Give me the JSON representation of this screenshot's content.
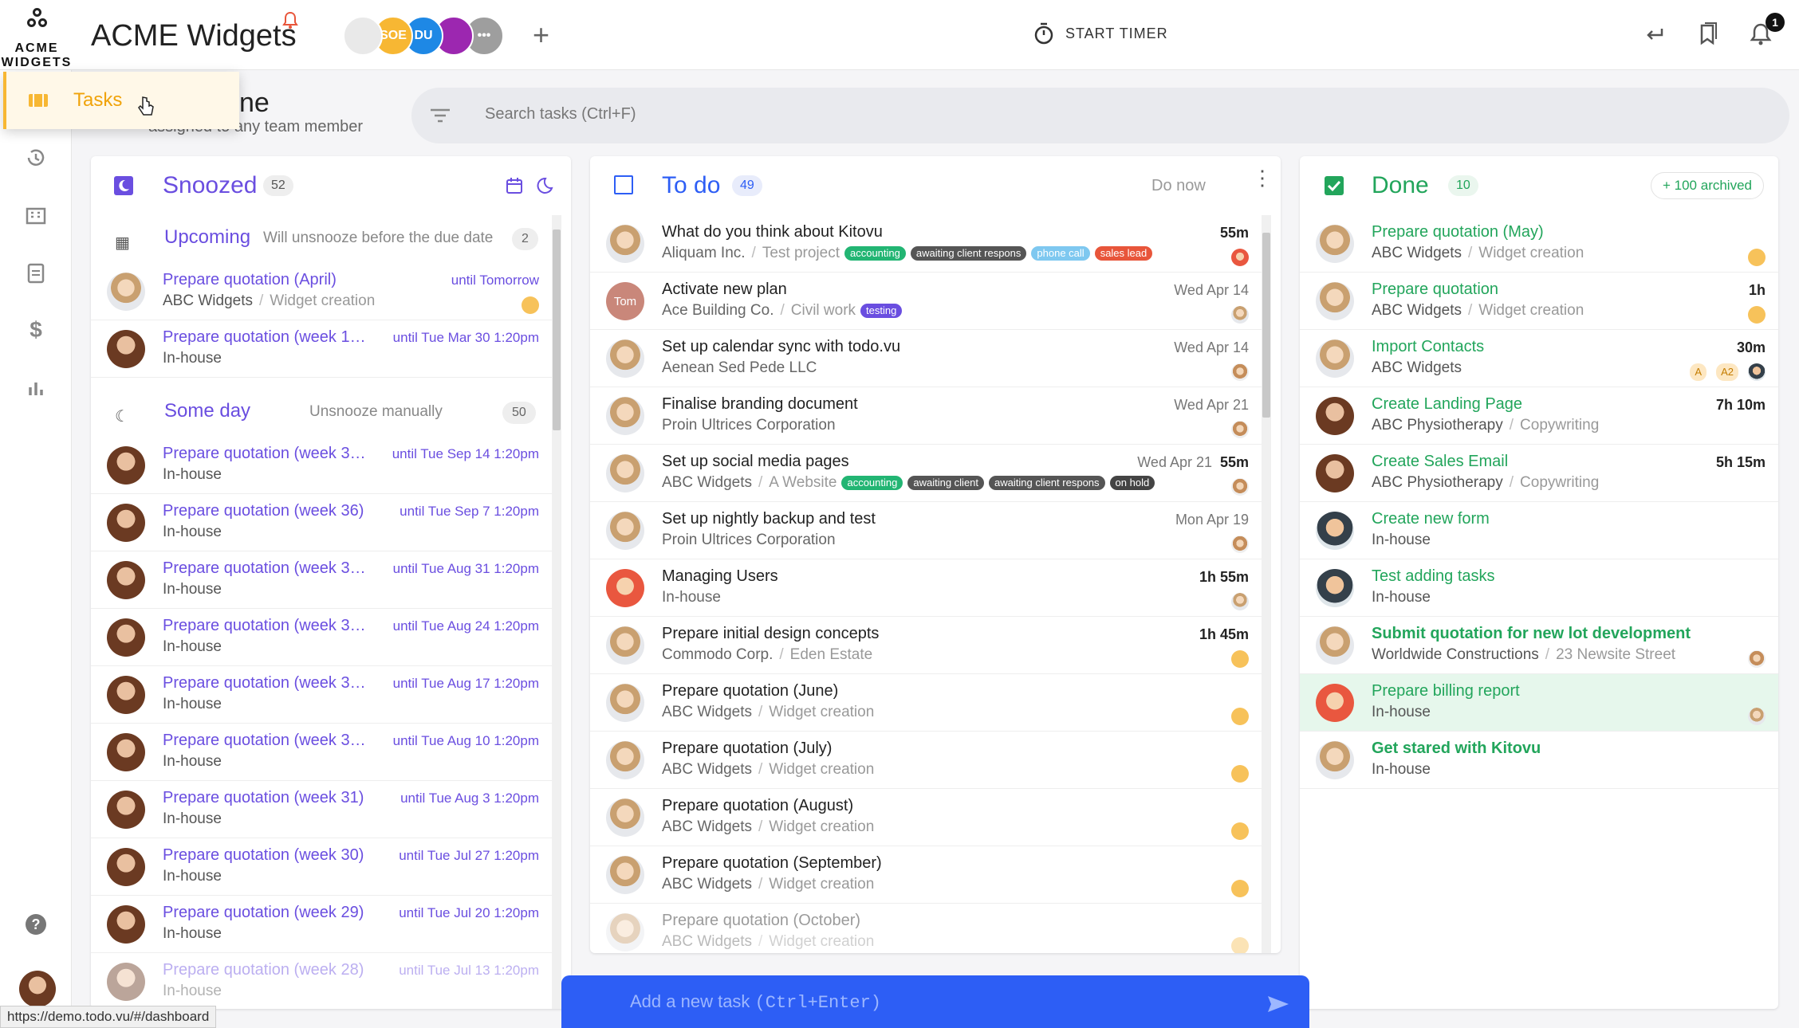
{
  "app": {
    "logo_line1": "ACME",
    "logo_line2": "WIDGETS",
    "title": "ACME Widgets"
  },
  "team_avatars": [
    {
      "initials": "",
      "color": "#e9e9e9"
    },
    {
      "initials": "SOE",
      "color": "#f7b733"
    },
    {
      "initials": "DU",
      "color": "#1e88e5"
    },
    {
      "initials": "",
      "color": "#9c27b0"
    },
    {
      "initials": "•••",
      "color": "#9e9e9e"
    }
  ],
  "header": {
    "timer_label": "START TIMER",
    "notification_count": "1"
  },
  "nav": {
    "tasks_label": "Tasks"
  },
  "page": {
    "title_partial": "ne",
    "subtitle": "assigned to any team member"
  },
  "search": {
    "placeholder": "Search tasks (Ctrl+F)"
  },
  "snoozed": {
    "title": "Snoozed",
    "count": "52",
    "upcoming": {
      "label": "Upcoming",
      "desc": "Will unsnooze before the due date",
      "count": "2"
    },
    "someday": {
      "label": "Some day",
      "desc": "Unsnooze manually",
      "count": "50"
    },
    "upcoming_items": [
      {
        "title": "Prepare quotation (April)",
        "project": "ABC Widgets",
        "sub": "Widget creation",
        "until": "until Tomorrow",
        "avatar": "glasses",
        "bold_project": true
      },
      {
        "title": "Prepare quotation (week 1…",
        "project": "In-house",
        "sub": "",
        "until": "until Tue Mar 30 1:20pm",
        "avatar": "photo"
      }
    ],
    "someday_items": [
      {
        "title": "Prepare quotation (week 3…",
        "project": "In-house",
        "until": "until Tue Sep 14 1:20pm"
      },
      {
        "title": "Prepare quotation (week 36)",
        "project": "In-house",
        "until": "until Tue Sep 7 1:20pm"
      },
      {
        "title": "Prepare quotation (week 3…",
        "project": "In-house",
        "until": "until Tue Aug 31 1:20pm"
      },
      {
        "title": "Prepare quotation (week 3…",
        "project": "In-house",
        "until": "until Tue Aug 24 1:20pm"
      },
      {
        "title": "Prepare quotation (week 3…",
        "project": "In-house",
        "until": "until Tue Aug 17 1:20pm"
      },
      {
        "title": "Prepare quotation (week 3…",
        "project": "In-house",
        "until": "until Tue Aug 10 1:20pm"
      },
      {
        "title": "Prepare quotation (week 31)",
        "project": "In-house",
        "until": "until Tue Aug 3 1:20pm"
      },
      {
        "title": "Prepare quotation (week 30)",
        "project": "In-house",
        "until": "until Tue Jul 27 1:20pm"
      },
      {
        "title": "Prepare quotation (week 29)",
        "project": "In-house",
        "until": "until Tue Jul 20 1:20pm"
      },
      {
        "title": "Prepare quotation (week 28)",
        "project": "In-house",
        "until": "until Tue Jul 13 1:20pm"
      }
    ]
  },
  "todo": {
    "title": "To do",
    "count": "49",
    "do_now": "Do now",
    "items": [
      {
        "title": "What do you think about Kitovu",
        "project": "Aliquam Inc.",
        "sub": "Test project",
        "date": "",
        "time": "55m",
        "avatar": "glasses",
        "tags": [
          {
            "t": "accounting",
            "c": "#22b573"
          },
          {
            "t": "awaiting client respons",
            "c": "#555"
          },
          {
            "t": "phone call",
            "c": "#7ec8f0"
          },
          {
            "t": "sales lead",
            "c": "#e8553a"
          }
        ],
        "assignee": "red"
      },
      {
        "title": "Activate new plan",
        "project": "Ace Building Co.",
        "sub": "Civil work",
        "date": "Wed Apr 14",
        "time": "",
        "avatar": "tom",
        "tags": [
          {
            "t": "testing",
            "c": "#6a4ee0"
          }
        ],
        "assignee": "glasses"
      },
      {
        "title": "Set up calendar sync with todo.vu",
        "project": "Aenean Sed Pede LLC",
        "sub": "",
        "date": "Wed Apr 14",
        "time": "",
        "avatar": "glasses",
        "tags": [],
        "assignee": "lady"
      },
      {
        "title": "Finalise branding document",
        "project": "Proin Ultrices Corporation",
        "sub": "",
        "date": "Wed Apr 21",
        "time": "",
        "avatar": "glasses",
        "tags": [],
        "assignee": "lady"
      },
      {
        "title": "Set up social media pages",
        "project": "ABC Widgets",
        "sub": "A Website",
        "date": "Wed Apr 21",
        "time": "55m",
        "avatar": "glasses",
        "tags": [
          {
            "t": "accounting",
            "c": "#22b573"
          },
          {
            "t": "awaiting client",
            "c": "#555"
          },
          {
            "t": "awaiting client respons",
            "c": "#555"
          },
          {
            "t": "on hold",
            "c": "#444"
          }
        ],
        "assignee": "lady"
      },
      {
        "title": "Set up nightly backup and test",
        "project": "Proin Ultrices Corporation",
        "sub": "",
        "date": "Mon Apr 19",
        "time": "",
        "avatar": "glasses",
        "tags": [],
        "assignee": "lady"
      },
      {
        "title": "Managing Users",
        "project": "In-house",
        "sub": "",
        "date": "",
        "time": "1h 55m",
        "avatar": "red",
        "tags": [],
        "assignee": "glasses"
      },
      {
        "title": "Prepare initial design concepts",
        "project": "Commodo Corp.",
        "sub": "Eden Estate",
        "date": "",
        "time": "1h 45m",
        "avatar": "glasses",
        "tags": [],
        "assignee": "gold"
      },
      {
        "title": "Prepare quotation (June)",
        "project": "ABC Widgets",
        "sub": "Widget creation",
        "date": "",
        "time": "",
        "avatar": "glasses",
        "tags": [],
        "assignee": "gold"
      },
      {
        "title": "Prepare quotation (July)",
        "project": "ABC Widgets",
        "sub": "Widget creation",
        "date": "",
        "time": "",
        "avatar": "glasses",
        "tags": [],
        "assignee": "gold"
      },
      {
        "title": "Prepare quotation (August)",
        "project": "ABC Widgets",
        "sub": "Widget creation",
        "date": "",
        "time": "",
        "avatar": "glasses",
        "tags": [],
        "assignee": "gold"
      },
      {
        "title": "Prepare quotation (September)",
        "project": "ABC Widgets",
        "sub": "Widget creation",
        "date": "",
        "time": "",
        "avatar": "glasses",
        "tags": [],
        "assignee": "gold"
      },
      {
        "title": "Prepare quotation (October)",
        "project": "ABC Widgets",
        "sub": "Widget creation",
        "date": "",
        "time": "",
        "avatar": "glasses",
        "tags": [],
        "assignee": "gold"
      }
    ]
  },
  "done": {
    "title": "Done",
    "count": "10",
    "archived": "+ 100 archived",
    "items": [
      {
        "title": "Prepare quotation (May)",
        "project": "ABC Widgets",
        "sub": "Widget creation",
        "time": "",
        "avatar": "glasses",
        "bold": false,
        "badges": [],
        "assignee": "gold"
      },
      {
        "title": "Prepare quotation",
        "project": "ABC Widgets",
        "sub": "Widget creation",
        "time": "1h",
        "avatar": "glasses",
        "bold": false,
        "badges": [],
        "assignee": "gold"
      },
      {
        "title": "Import Contacts",
        "project": "ABC Widgets",
        "sub": "",
        "time": "30m",
        "avatar": "glasses",
        "bold": false,
        "badges": [
          "A",
          "A2"
        ],
        "assignee": "man"
      },
      {
        "title": "Create Landing Page",
        "project": "ABC Physiotherapy",
        "sub": "Copywriting",
        "time": "7h 10m",
        "avatar": "photo",
        "bold": false,
        "badges": [],
        "assignee": ""
      },
      {
        "title": "Create Sales Email",
        "project": "ABC Physiotherapy",
        "sub": "Copywriting",
        "time": "5h 15m",
        "avatar": "photo",
        "bold": false,
        "badges": [],
        "assignee": ""
      },
      {
        "title": "Create new form",
        "project": "In-house",
        "sub": "",
        "time": "",
        "avatar": "man",
        "bold": false,
        "badges": [],
        "assignee": ""
      },
      {
        "title": "Test adding tasks",
        "project": "In-house",
        "sub": "",
        "time": "",
        "avatar": "man",
        "bold": false,
        "badges": [],
        "assignee": ""
      },
      {
        "title": "Submit quotation for new lot development",
        "project": "Worldwide Constructions",
        "sub": "23 Newsite Street",
        "time": "",
        "avatar": "glasses",
        "bold": true,
        "badges": [],
        "assignee": "lady"
      },
      {
        "title": "Prepare billing report",
        "project": "In-house",
        "sub": "",
        "time": "",
        "avatar": "red",
        "bold": false,
        "badges": [],
        "assignee": "glasses",
        "highlight": true
      },
      {
        "title": "Get stared with Kitovu",
        "project": "In-house",
        "sub": "",
        "time": "",
        "avatar": "glasses",
        "bold": true,
        "badges": [],
        "assignee": ""
      }
    ]
  },
  "add_task": {
    "label": "Add a new task",
    "shortcut": "(Ctrl+Enter)"
  },
  "status_url": "https://demo.todo.vu/#/dashboard",
  "colors": {
    "snoozed": "#6a4ee0",
    "todo": "#2d5ef5",
    "done": "#22a55b",
    "tasks_active": "#f0a30a"
  }
}
